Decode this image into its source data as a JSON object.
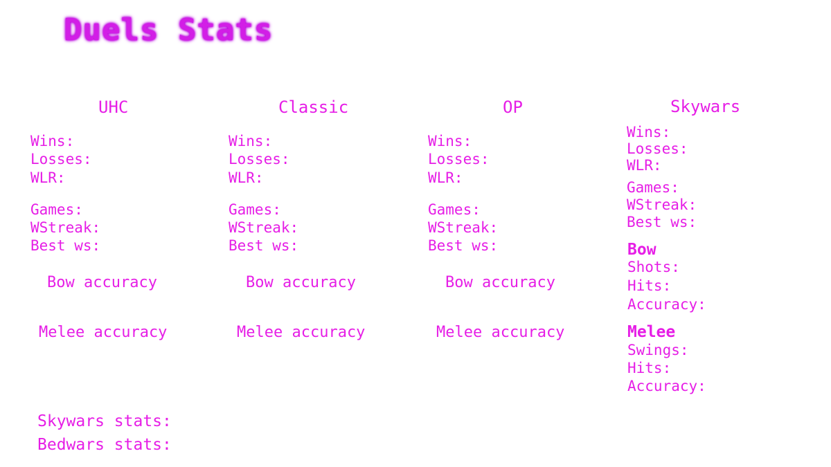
{
  "title": "Duels Stats",
  "columns": [
    {
      "heading": "UHC",
      "wins": "Wins:",
      "losses": "Losses:",
      "wlr": "WLR:",
      "games": "Games:",
      "wstreak": "WStreak:",
      "best_ws": "Best ws:",
      "bow_accuracy": "Bow accuracy",
      "melee_accuracy": "Melee accuracy"
    },
    {
      "heading": "Classic",
      "wins": "Wins:",
      "losses": "Losses:",
      "wlr": "WLR:",
      "games": "Games:",
      "wstreak": "WStreak:",
      "best_ws": "Best ws:",
      "bow_accuracy": "Bow accuracy",
      "melee_accuracy": "Melee accuracy"
    },
    {
      "heading": "OP",
      "wins": "Wins:",
      "losses": "Losses:",
      "wlr": "WLR:",
      "games": "Games:",
      "wstreak": "WStreak:",
      "best_ws": "Best ws:",
      "bow_accuracy": "Bow accuracy",
      "melee_accuracy": "Melee accuracy"
    }
  ],
  "skywars": {
    "heading": "Skywars",
    "wins": "Wins:",
    "losses": "Losses:",
    "wlr": "WLR:",
    "games": "Games:",
    "wstreak": "WStreak:",
    "best_ws": "Best ws:",
    "bow_heading": "Bow",
    "bow_shots": "Shots:",
    "bow_hits": "Hits:",
    "bow_accuracy": "Accuracy:",
    "melee_heading": "Melee",
    "melee_swings": "Swings:",
    "melee_hits": "Hits:",
    "melee_accuracy": "Accuracy:"
  },
  "footer": {
    "skywars_stats": "Skywars stats:",
    "bedwars_stats": "Bedwars stats:"
  }
}
